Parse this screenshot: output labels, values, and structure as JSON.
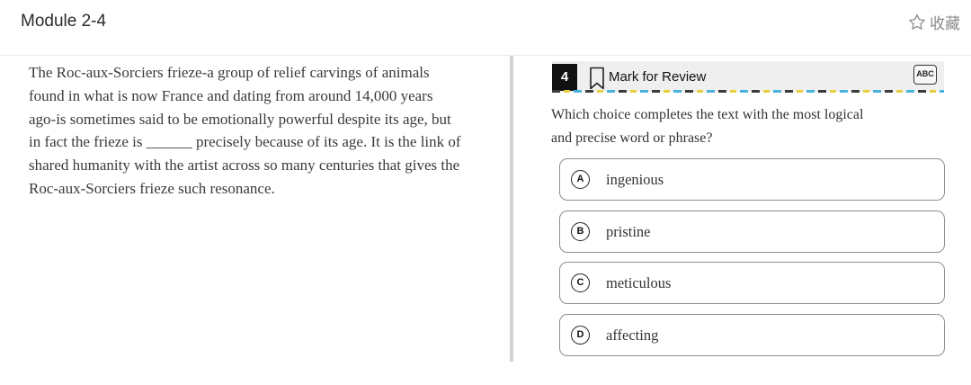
{
  "header": {
    "module_title": "Module 2-4",
    "favorite_label": "收藏",
    "favorite_icon": "star-outline-icon"
  },
  "passage": {
    "lines": [
      "The Roc-aux-Sorciers frieze-a group of relief carvings of animals",
      "found in what is now France and dating from around 14,000 years",
      "ago-is sometimes said to be emotionally powerful despite its age, but",
      "in fact the frieze is ______ precisely because of its age. It is the link of",
      "shared humanity with the artist across so many centuries that gives the",
      "Roc-aux-Sorciers frieze such resonance."
    ]
  },
  "question": {
    "number": "4",
    "bookmark_icon": "bookmark-icon",
    "mark_for_review_label": "Mark for Review",
    "abc_tool_label": "ABC",
    "prompt_lines": [
      "Which choice completes the text with the most logical",
      "and precise word or phrase?"
    ],
    "choices": [
      {
        "letter": "A",
        "text": "ingenious"
      },
      {
        "letter": "B",
        "text": "pristine"
      },
      {
        "letter": "C",
        "text": "meticulous"
      },
      {
        "letter": "D",
        "text": "affecting"
      }
    ]
  },
  "colors": {
    "dash_dark": "#3a3a3a",
    "dash_yellow": "#e8cf3c",
    "dash_blue": "#48b3df",
    "question_number_bg": "#111111"
  }
}
